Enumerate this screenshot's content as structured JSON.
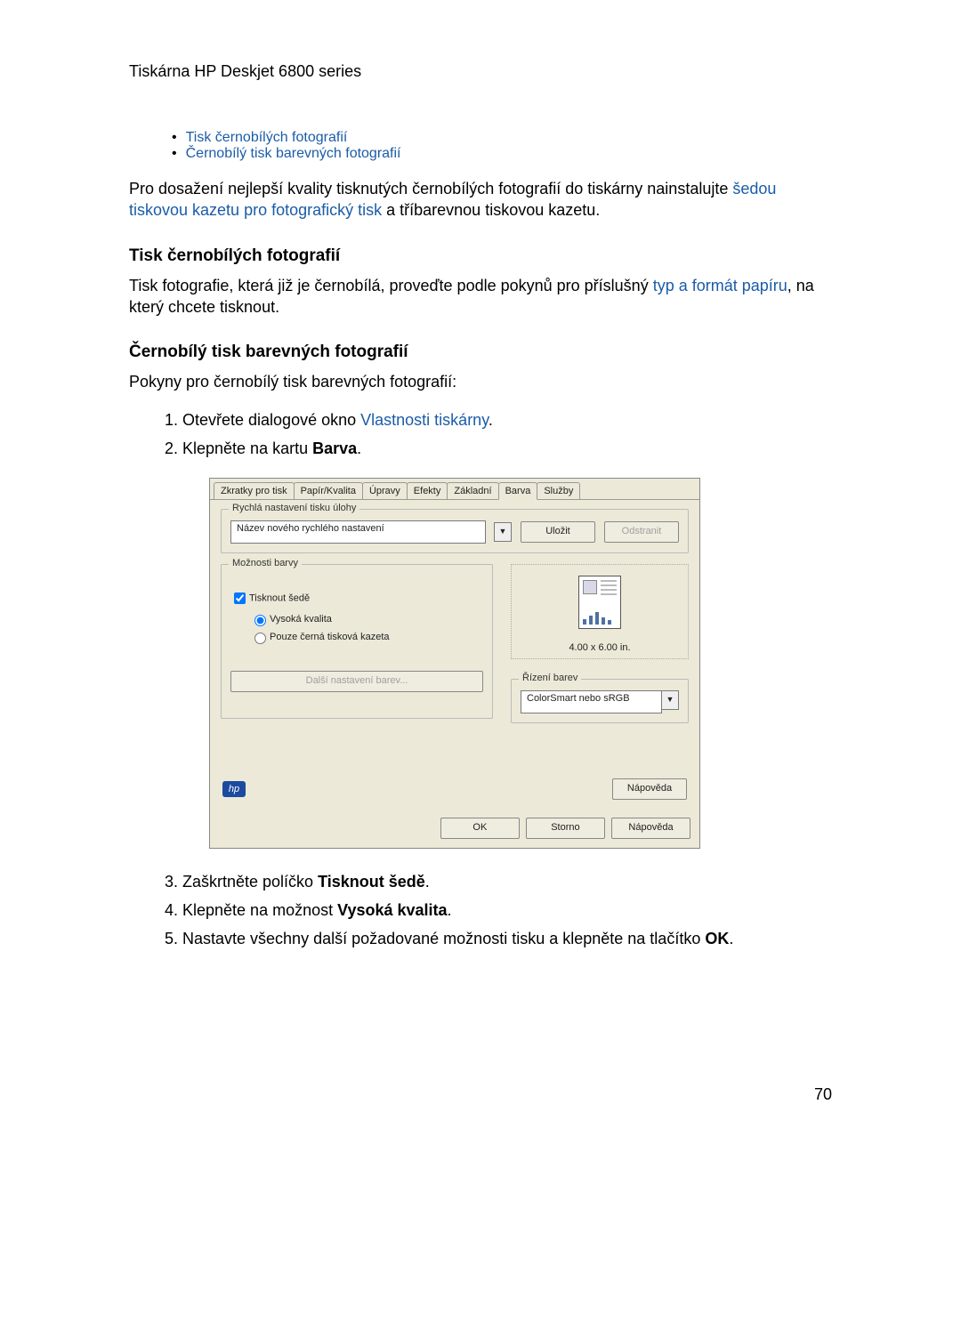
{
  "header": "Tiskárna HP Deskjet 6800 series",
  "toc": {
    "item1": "Tisk černobílých fotografií",
    "item2": "Černobílý tisk barevných fotografií"
  },
  "para1_a": "Pro dosažení nejlepší kvality tisknutých černobílých fotografií do tiskárny nainstalujte ",
  "para1_link": "šedou tiskovou kazetu pro fotografický tisk",
  "para1_b": " a tříbarevnou tiskovou kazetu.",
  "h1": "Tisk černobílých fotografií",
  "para2_a": "Tisk fotografie, která již je černobílá, proveďte podle pokynů pro příslušný ",
  "para2_link": "typ a formát papíru",
  "para2_b": ", na který chcete tisknout.",
  "h2": "Černobílý tisk barevných fotografií",
  "para3": "Pokyny pro černobílý tisk barevných fotografií:",
  "steps": {
    "s1a": "Otevřete dialogové okno ",
    "s1link": "Vlastnosti tiskárny",
    "s1b": ".",
    "s2a": "Klepněte na kartu ",
    "s2b": "Barva",
    "s2c": ".",
    "s3a": "Zaškrtněte políčko ",
    "s3b": "Tisknout šedě",
    "s3c": ".",
    "s4a": "Klepněte na možnost ",
    "s4b": "Vysoká kvalita",
    "s4c": ".",
    "s5a": "Nastavte všechny další požadované možnosti tisku a klepněte na tlačítko ",
    "s5b": "OK",
    "s5c": "."
  },
  "dialog": {
    "tabs": [
      "Zkratky pro tisk",
      "Papír/Kvalita",
      "Úpravy",
      "Efekty",
      "Základní",
      "Barva",
      "Služby"
    ],
    "group_quick": "Rychlá nastavení tisku úlohy",
    "quick_value": "Název nového rychlého nastavení",
    "save": "Uložit",
    "delete": "Odstranit",
    "group_color": "Možnosti barvy",
    "chk_gray": "Tisknout šedě",
    "radio_hq": "Vysoká kvalita",
    "radio_black": "Pouze černá tisková kazeta",
    "more_color": "Další nastavení barev...",
    "preview_dim": "4.00 x 6.00 in.",
    "group_mgmt": "Řízení barev",
    "mgmt_value": "ColorSmart nebo sRGB",
    "help": "Nápověda",
    "ok": "OK",
    "cancel": "Storno",
    "help2": "Nápověda"
  },
  "page_number": "70"
}
